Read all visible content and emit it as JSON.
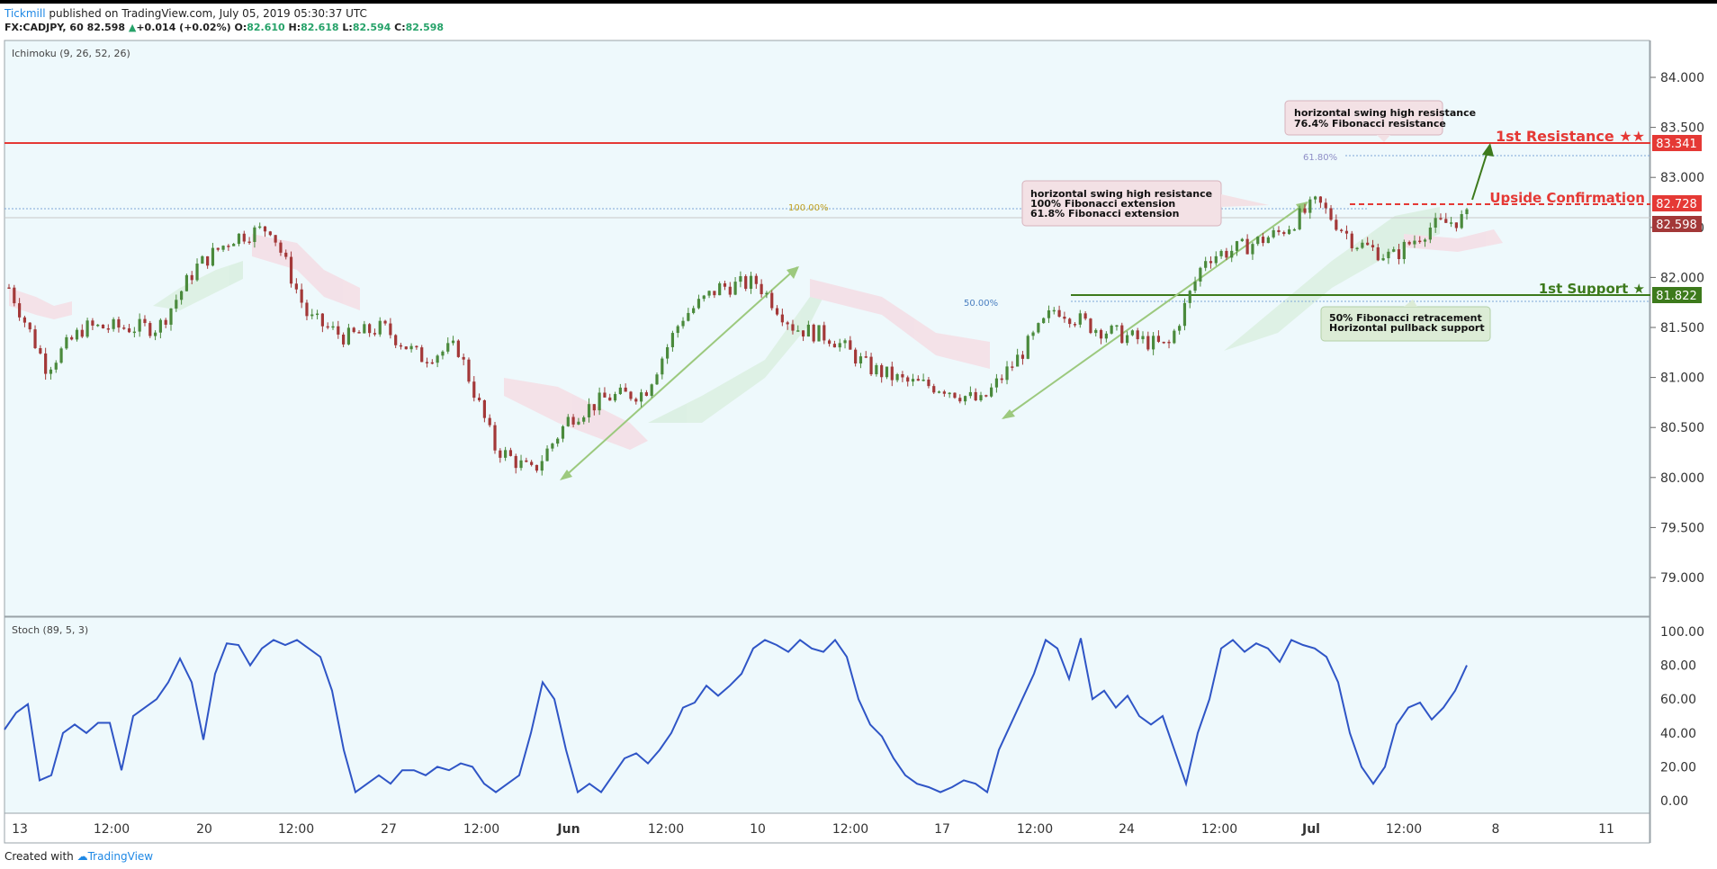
{
  "header": {
    "publisher": "Tickmill",
    "published_text": "published on TradingView.com, July 05, 2019 05:30:37 UTC",
    "symbol": "FX:CADJPY, 60",
    "last": "82.598",
    "change_symbol": "▲",
    "change": "+0.014 (+0.02%)",
    "o_label": "O:",
    "o": "82.610",
    "h_label": "H:",
    "h": "82.618",
    "l_label": "L:",
    "l": "82.594",
    "c_label": "C:",
    "c": "82.598"
  },
  "footer": {
    "created_with": "Created with",
    "brand": "TradingView"
  },
  "main_panel": {
    "indicator_label": "Ichimoku (9, 26, 52, 26)"
  },
  "sub_panel": {
    "indicator_label": "Stoch (89, 5, 3)"
  },
  "colors": {
    "background": "#eef9fc",
    "resistance": "#e53935",
    "support": "#3d7a1c",
    "fib_line": "#7fa7d9",
    "stoch_line": "#2f55c6",
    "candle_up": "#4a8a3c",
    "candle_down": "#a33838",
    "price_tag": "#c8c8c8"
  },
  "annotations": {
    "resistance_label": "1st Resistance ★★",
    "resistance_price": "83.341",
    "upside_label": "Upside Confirmation",
    "upside_price": "82.728",
    "current_price": "82.598",
    "support_label": "1st Support ★",
    "support_price": "81.822",
    "fib_618": "61.80%",
    "fib_100": "100.00%",
    "fib_50": "50.00%",
    "box_top": [
      "horizontal swing high resistance",
      "76.4% Fibonacci resistance"
    ],
    "box_mid": [
      "horizontal swing high resistance",
      "100% Fibonacci extension",
      "61.8% Fibonacci extension"
    ],
    "box_bottom": [
      "50% Fibonacci retracement",
      "Horizontal pullback support"
    ]
  },
  "chart_data": [
    {
      "type": "candlestick",
      "symbol": "FX:CADJPY",
      "interval": "60",
      "y_ticks": [
        "84.000",
        "83.500",
        "83.000",
        "82.500",
        "82.000",
        "81.500",
        "81.000",
        "80.500",
        "80.000",
        "79.500",
        "79.000"
      ],
      "ylim": [
        78.6,
        84.4
      ],
      "x_ticks": [
        "13",
        "12:00",
        "20",
        "12:00",
        "27",
        "12:00",
        "Jun",
        "12:00",
        "10",
        "12:00",
        "17",
        "12:00",
        "24",
        "12:00",
        "Jul",
        "12:00",
        "8",
        "11"
      ],
      "approx_close_path": [
        {
          "x": "May 13",
          "y": 81.9
        },
        {
          "x": "May 14",
          "y": 81.1
        },
        {
          "x": "May 15",
          "y": 81.5
        },
        {
          "x": "May 16",
          "y": 81.5
        },
        {
          "x": "May 17",
          "y": 81.5
        },
        {
          "x": "May 20",
          "y": 82.1
        },
        {
          "x": "May 21",
          "y": 82.4
        },
        {
          "x": "May 22",
          "y": 82.5
        },
        {
          "x": "May 23",
          "y": 81.6
        },
        {
          "x": "May 24",
          "y": 81.4
        },
        {
          "x": "May 27",
          "y": 81.5
        },
        {
          "x": "May 28",
          "y": 81.2
        },
        {
          "x": "May 29",
          "y": 81.3
        },
        {
          "x": "May 30",
          "y": 80.3
        },
        {
          "x": "May 31",
          "y": 80.05
        },
        {
          "x": "Jun 3",
          "y": 80.6
        },
        {
          "x": "Jun 4",
          "y": 80.8
        },
        {
          "x": "Jun 5",
          "y": 80.85
        },
        {
          "x": "Jun 6",
          "y": 81.6
        },
        {
          "x": "Jun 7",
          "y": 81.9
        },
        {
          "x": "Jun 10",
          "y": 81.95
        },
        {
          "x": "Jun 11",
          "y": 81.5
        },
        {
          "x": "Jun 12",
          "y": 81.4
        },
        {
          "x": "Jun 13",
          "y": 81.1
        },
        {
          "x": "Jun 14",
          "y": 80.95
        },
        {
          "x": "Jun 17",
          "y": 80.9
        },
        {
          "x": "Jun 18",
          "y": 80.75
        },
        {
          "x": "Jun 19",
          "y": 81.2
        },
        {
          "x": "Jun 20",
          "y": 81.7
        },
        {
          "x": "Jun 21",
          "y": 81.5
        },
        {
          "x": "Jun 24",
          "y": 81.4
        },
        {
          "x": "Jun 25",
          "y": 81.3
        },
        {
          "x": "Jun 26",
          "y": 82.2
        },
        {
          "x": "Jun 27",
          "y": 82.3
        },
        {
          "x": "Jun 28",
          "y": 82.45
        },
        {
          "x": "Jul 1",
          "y": 82.75
        },
        {
          "x": "Jul 2",
          "y": 82.35
        },
        {
          "x": "Jul 3",
          "y": 82.2
        },
        {
          "x": "Jul 4",
          "y": 82.5
        },
        {
          "x": "Jul 5",
          "y": 82.598
        }
      ],
      "horizontal_levels": [
        {
          "name": "1st Resistance",
          "value": 83.341
        },
        {
          "name": "Upside Confirmation",
          "value": 82.728
        },
        {
          "name": "Current",
          "value": 82.598
        },
        {
          "name": "1st Support",
          "value": 81.822
        }
      ]
    },
    {
      "type": "line",
      "name": "Stoch (89, 5, 3)",
      "y_ticks": [
        "100.00",
        "80.00",
        "60.00",
        "40.00",
        "20.00",
        "0.00"
      ],
      "ylim": [
        -8,
        104
      ],
      "values": [
        42,
        52,
        57,
        12,
        15,
        40,
        45,
        40,
        46,
        46,
        18,
        50,
        55,
        60,
        70,
        84,
        70,
        36,
        75,
        93,
        92,
        80,
        90,
        95,
        92,
        95,
        90,
        85,
        65,
        30,
        5,
        10,
        15,
        10,
        18,
        18,
        15,
        20,
        18,
        22,
        20,
        10,
        5,
        10,
        15,
        40,
        70,
        60,
        30,
        5,
        10,
        5,
        15,
        25,
        28,
        22,
        30,
        40,
        55,
        58,
        68,
        62,
        68,
        75,
        90,
        95,
        92,
        88,
        95,
        90,
        88,
        95,
        85,
        60,
        45,
        38,
        25,
        15,
        10,
        8,
        5,
        8,
        12,
        10,
        5,
        30,
        45,
        60,
        75,
        95,
        90,
        72,
        96,
        60,
        65,
        55,
        62,
        50,
        45,
        50,
        30,
        10,
        40,
        60,
        90,
        95,
        88,
        93,
        90,
        82,
        95,
        92,
        90,
        85,
        70,
        40,
        20,
        10,
        20,
        45,
        55,
        58,
        48,
        55,
        65,
        80
      ]
    }
  ]
}
